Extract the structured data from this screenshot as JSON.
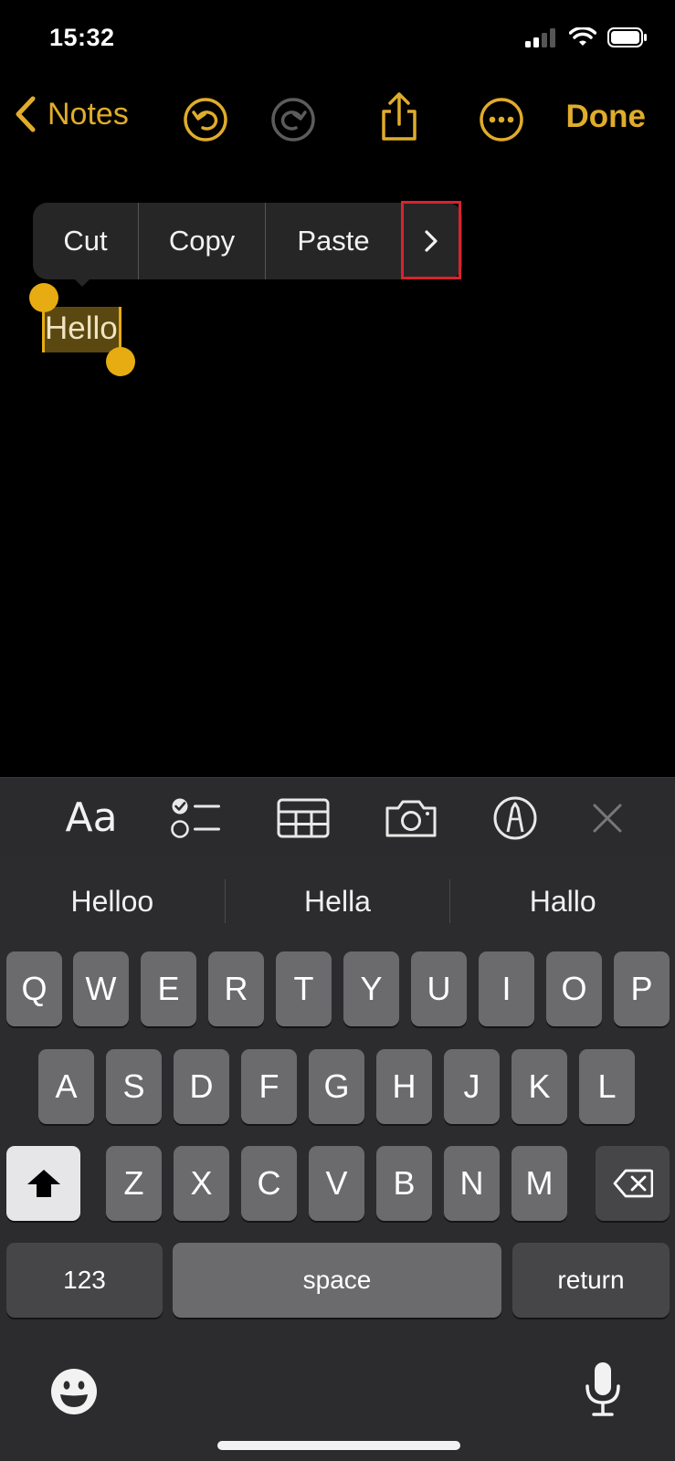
{
  "status": {
    "time": "15:32"
  },
  "nav": {
    "back_label": "Notes",
    "done_label": "Done"
  },
  "edit_menu": {
    "items": [
      "Cut",
      "Copy",
      "Paste"
    ]
  },
  "note": {
    "selected_text": "Hello"
  },
  "toolbar": {
    "format_label": "Aa"
  },
  "suggestions": [
    "Helloo",
    "Hella",
    "Hallo"
  ],
  "keyboard": {
    "row1": [
      "Q",
      "W",
      "E",
      "R",
      "T",
      "Y",
      "U",
      "I",
      "O",
      "P"
    ],
    "row2": [
      "A",
      "S",
      "D",
      "F",
      "G",
      "H",
      "J",
      "K",
      "L"
    ],
    "row3": [
      "Z",
      "X",
      "C",
      "V",
      "B",
      "N",
      "M"
    ],
    "numbers_label": "123",
    "space_label": "space",
    "return_label": "return"
  },
  "colors": {
    "accent": "#e0ac2b",
    "selection": "#e6ac12",
    "highlight_box": "#d8232e"
  }
}
